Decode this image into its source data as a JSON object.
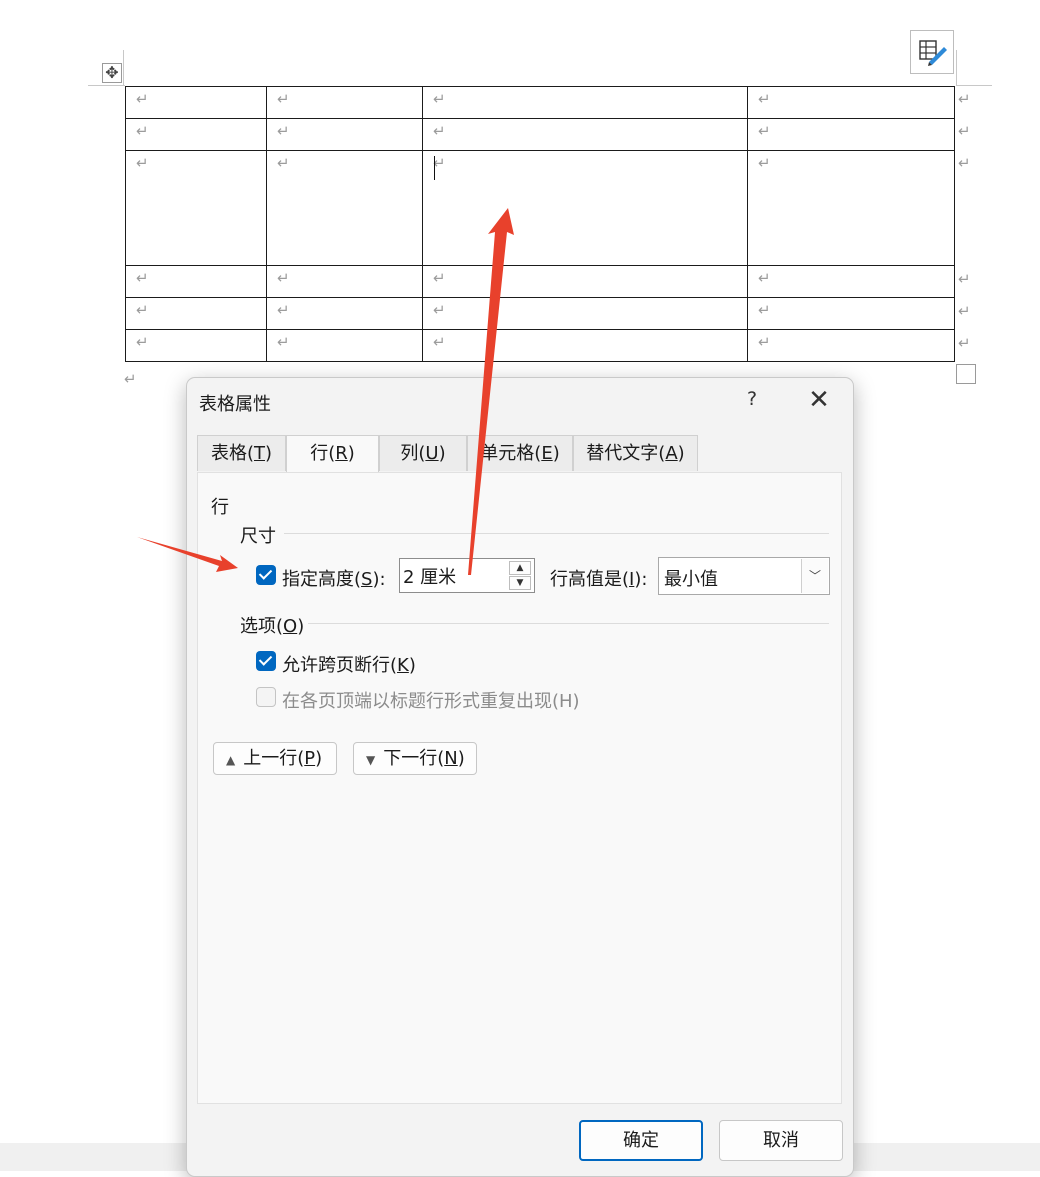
{
  "document": {
    "paragraph_mark": "↵",
    "move_icon_glyph": "✥",
    "table": {
      "rows": [
        [
          "↵",
          "↵",
          "↵",
          "↵"
        ],
        [
          "↵",
          "↵",
          "↵",
          "↵"
        ],
        [
          "↵",
          "↵",
          "↵",
          "↵"
        ],
        [
          "↵",
          "↵",
          "↵",
          "↵"
        ],
        [
          "↵",
          "↵",
          "↵",
          "↵"
        ],
        [
          "↵",
          "↵",
          "↵",
          "↵"
        ]
      ]
    }
  },
  "dialog": {
    "title": "表格属性",
    "help_label": "?",
    "close_label": "✕",
    "tabs": [
      {
        "label": "表格(",
        "key": "T",
        "suffix": ")"
      },
      {
        "label": "行(",
        "key": "R",
        "suffix": ")",
        "active": true
      },
      {
        "label": "列(",
        "key": "U",
        "suffix": ")"
      },
      {
        "label": "单元格(",
        "key": "E",
        "suffix": ")"
      },
      {
        "label": "替代文字(",
        "key": "A",
        "suffix": ")"
      }
    ],
    "row_section_title": "行",
    "size_group": {
      "title": "尺寸",
      "specify_height": {
        "label_prefix": "指定高度(",
        "key": "S",
        "label_suffix": "):",
        "checked": true
      },
      "height_value": "2 厘米",
      "row_height_is": {
        "label_prefix": "行高值是(",
        "key": "I",
        "label_suffix": "):"
      },
      "row_height_mode": "最小值"
    },
    "options_group": {
      "title_prefix": "选项(",
      "key": "O",
      "title_suffix": ")",
      "allow_break": {
        "label_prefix": "允许跨页断行(",
        "key": "K",
        "label_suffix": ")",
        "checked": true
      },
      "repeat_header": {
        "label": "在各页顶端以标题行形式重复出现(H)",
        "checked": false,
        "disabled": true
      }
    },
    "prev_row": {
      "label_prefix": "上一行(",
      "key": "P",
      "label_suffix": ")"
    },
    "next_row": {
      "label_prefix": "下一行(",
      "key": "N",
      "label_suffix": ")"
    },
    "ok_label": "确定",
    "cancel_label": "取消"
  },
  "colors": {
    "accent": "#0067c0",
    "annotation_arrow": "#e8412c"
  },
  "icons": [
    "move-handle-icon",
    "table-layout-icon",
    "question-icon",
    "close-icon",
    "checkbox-checked-icon",
    "spin-up-icon",
    "spin-down-icon",
    "chevron-down-icon",
    "triangle-up-icon",
    "triangle-down-icon"
  ]
}
